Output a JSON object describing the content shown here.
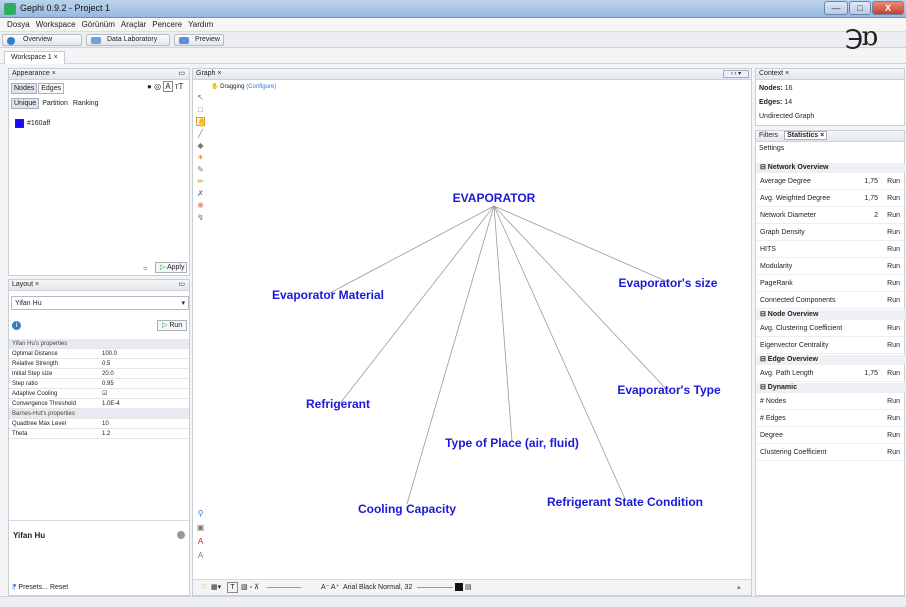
{
  "window": {
    "title": "Gephi 0.9.2 - Project 1",
    "min_glyph": "—",
    "max_glyph": "□",
    "close_glyph": "X"
  },
  "menu": [
    "Dosya",
    "Workspace",
    "Görünüm",
    "Araçlar",
    "Pencere",
    "Yardım"
  ],
  "perspectives": [
    {
      "label": "Overview",
      "icon": "overview-icon",
      "color": "#2a7fd0"
    },
    {
      "label": "Data Laboratory",
      "icon": "data-laboratory-icon",
      "color": "#6ea0d8"
    },
    {
      "label": "Preview",
      "icon": "preview-icon",
      "color": "#5b8fd3"
    }
  ],
  "workspace_tab": "Workspace 1 ×",
  "appearance": {
    "header": "Appearance ×",
    "tabs": [
      "Nodes",
      "Edges"
    ],
    "subtabs": [
      "Unique",
      "Partition",
      "Ranking"
    ],
    "color_value": "#160aff",
    "color_hex": "#160aff",
    "apply": "Apply",
    "apply_icon": "play-icon"
  },
  "layout": {
    "header": "Layout ×",
    "algorithm": "Yifan Hu",
    "run": "Run",
    "rows": [
      {
        "k": "Yifan Hu's properties",
        "v": "",
        "section": true
      },
      {
        "k": "Optimal Distance",
        "v": "100.0"
      },
      {
        "k": "Relative Strength",
        "v": "0.5"
      },
      {
        "k": "Initial Step size",
        "v": "20.0"
      },
      {
        "k": "Step ratio",
        "v": "0.95"
      },
      {
        "k": "Adaptive Cooling",
        "v": "☑"
      },
      {
        "k": "Convergence Threshold",
        "v": "1.0E-4"
      },
      {
        "k": "Barnes-Hut's properties",
        "v": "",
        "section": true
      },
      {
        "k": "Quadtree Max Level",
        "v": "10"
      },
      {
        "k": "Theta",
        "v": "1.2"
      }
    ],
    "description_title": "Yifan Hu",
    "presets": "Presets...",
    "reset": "Reset"
  },
  "graph": {
    "header": "Graph ×",
    "mode": "Dragging",
    "configure": "(Configure)",
    "font_label": "Arial Black Normal, 32",
    "nodes": [
      {
        "id": "evaporator",
        "label": "EVAPORATOR"
      },
      {
        "id": "material",
        "label": "Evaporator Material"
      },
      {
        "id": "size",
        "label": "Evaporator's size"
      },
      {
        "id": "refrigerant",
        "label": "Refrigerant"
      },
      {
        "id": "type",
        "label": "Evaporator's Type"
      },
      {
        "id": "place",
        "label": "Type of Place (air, fluid)"
      },
      {
        "id": "cooling",
        "label": "Cooling Capacity"
      },
      {
        "id": "state",
        "label": "Refrigerant State Condition"
      }
    ],
    "edges": [
      [
        "evaporator",
        "material"
      ],
      [
        "evaporator",
        "size"
      ],
      [
        "evaporator",
        "refrigerant"
      ],
      [
        "evaporator",
        "type"
      ],
      [
        "evaporator",
        "place"
      ],
      [
        "evaporator",
        "cooling"
      ],
      [
        "evaporator",
        "state"
      ]
    ],
    "edge_color": "#9a9a9a",
    "label_color": "#1a1ad6"
  },
  "context": {
    "header": "Context ×",
    "nodes_label": "Nodes:",
    "nodes_value": "16",
    "edges_label": "Edges:",
    "edges_value": "14",
    "graph_type": "Undirected Graph"
  },
  "statistics": {
    "tabs": [
      "Filters",
      "Statistics ×"
    ],
    "settings": "Settings",
    "rows": [
      {
        "k": "⊟ Network Overview",
        "section": true
      },
      {
        "k": "Average Degree",
        "v": "1,75",
        "r": "Run"
      },
      {
        "k": "Avg. Weighted Degree",
        "v": "1,75",
        "r": "Run"
      },
      {
        "k": "Network Diameter",
        "v": "2",
        "r": "Run"
      },
      {
        "k": "Graph Density",
        "v": "",
        "r": "Run"
      },
      {
        "k": "HITS",
        "v": "",
        "r": "Run"
      },
      {
        "k": "Modularity",
        "v": "",
        "r": "Run"
      },
      {
        "k": "PageRank",
        "v": "",
        "r": "Run"
      },
      {
        "k": "Connected Components",
        "v": "",
        "r": "Run"
      },
      {
        "k": "⊟ Node Overview",
        "section": true
      },
      {
        "k": "Avg. Clustering Coefficient",
        "v": "",
        "r": "Run"
      },
      {
        "k": "Eigenvector Centrality",
        "v": "",
        "r": "Run"
      },
      {
        "k": "⊟ Edge Overview",
        "section": true
      },
      {
        "k": "Avg. Path Length",
        "v": "1,75",
        "r": "Run"
      },
      {
        "k": "⊟ Dynamic",
        "section": true
      },
      {
        "k": "# Nodes",
        "v": "",
        "r": "Run"
      },
      {
        "k": "# Edges",
        "v": "",
        "r": "Run"
      },
      {
        "k": "Degree",
        "v": "",
        "r": "Run"
      },
      {
        "k": "Clustering Coefficient",
        "v": "",
        "r": "Run"
      }
    ]
  }
}
